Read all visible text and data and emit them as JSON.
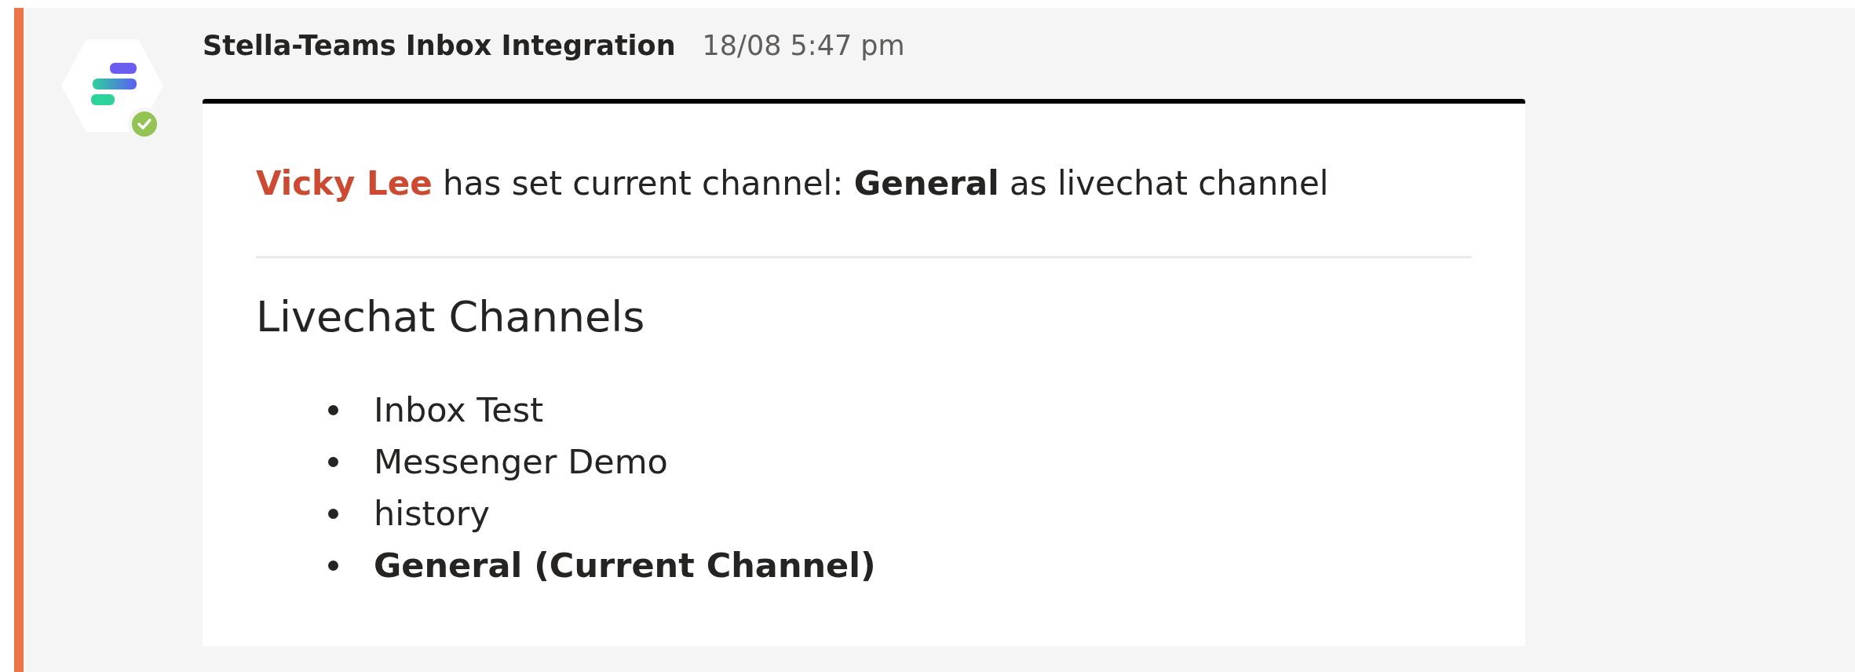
{
  "message": {
    "sender": "Stella-Teams Inbox Integration",
    "time": "18/08 5:47 pm",
    "online": true,
    "card": {
      "mention": "Vicky Lee",
      "text": "has set current channel: **General** as livechat channel",
      "heading": "Livechat Channels",
      "channels": [
        {
          "name": "Inbox Test",
          "current": false
        },
        {
          "name": "Messenger Demo",
          "current": false
        },
        {
          "name": "history",
          "current": false
        },
        {
          "name": "General (Current Channel)",
          "current": true
        }
      ]
    }
  }
}
